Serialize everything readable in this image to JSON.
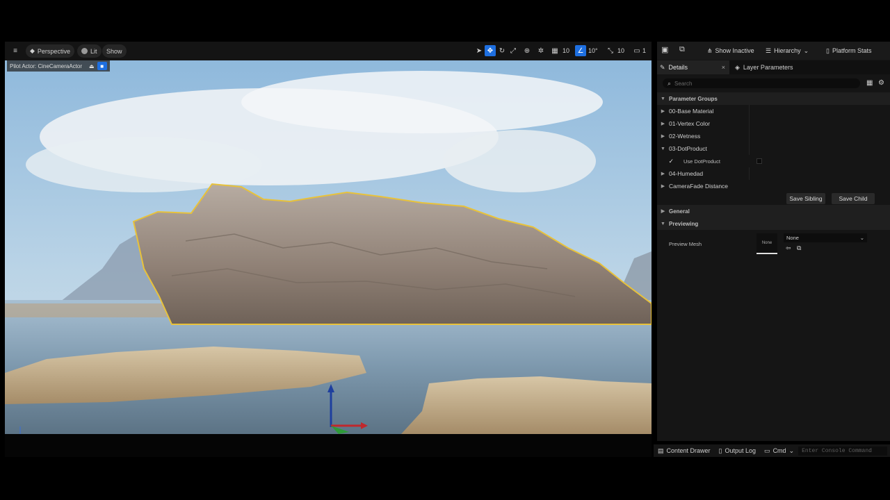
{
  "viewport": {
    "toolbar": {
      "menu_icon": "hamburger-icon",
      "perspective_label": "Perspective",
      "lit_label": "Lit",
      "show_label": "Show",
      "grid_snap_value": "10",
      "angle_snap_value": "10°",
      "scale_snap_value": "10",
      "camera_speed_value": "1"
    },
    "pilot": {
      "label": "Pilot Actor: CineCameraActor"
    }
  },
  "panel_toolbar": {
    "show_inactive": "Show Inactive",
    "hierarchy": "Hierarchy",
    "platform_stats": "Platform Stats"
  },
  "tabs": {
    "details": "Details",
    "layer_parameters": "Layer Parameters"
  },
  "search": {
    "placeholder": "Search"
  },
  "parameters": {
    "section_label": "Parameter Groups",
    "groups": [
      {
        "label": "00-Base Material"
      },
      {
        "label": "01-Vertex Color"
      },
      {
        "label": "02-Wetness"
      },
      {
        "label": "03-DotProduct"
      },
      {
        "label": "04-Humedad"
      },
      {
        "label": "CameraFade Distance"
      }
    ],
    "use_dotproduct_label": "Use DotProduct",
    "save_sibling": "Save Sibling",
    "save_child": "Save Child"
  },
  "general": {
    "label": "General"
  },
  "previewing": {
    "label": "Previewing",
    "preview_mesh_label": "Preview Mesh",
    "thumbnail_text": "None",
    "dropdown_value": "None"
  },
  "statusbar": {
    "content_drawer": "Content Drawer",
    "output_log": "Output Log",
    "cmd": "Cmd",
    "console_placeholder": "Enter Console Command"
  },
  "colors": {
    "accent_blue": "#1e6fe0",
    "selection_outline": "#e8c23a",
    "panel_bg": "#151515"
  }
}
